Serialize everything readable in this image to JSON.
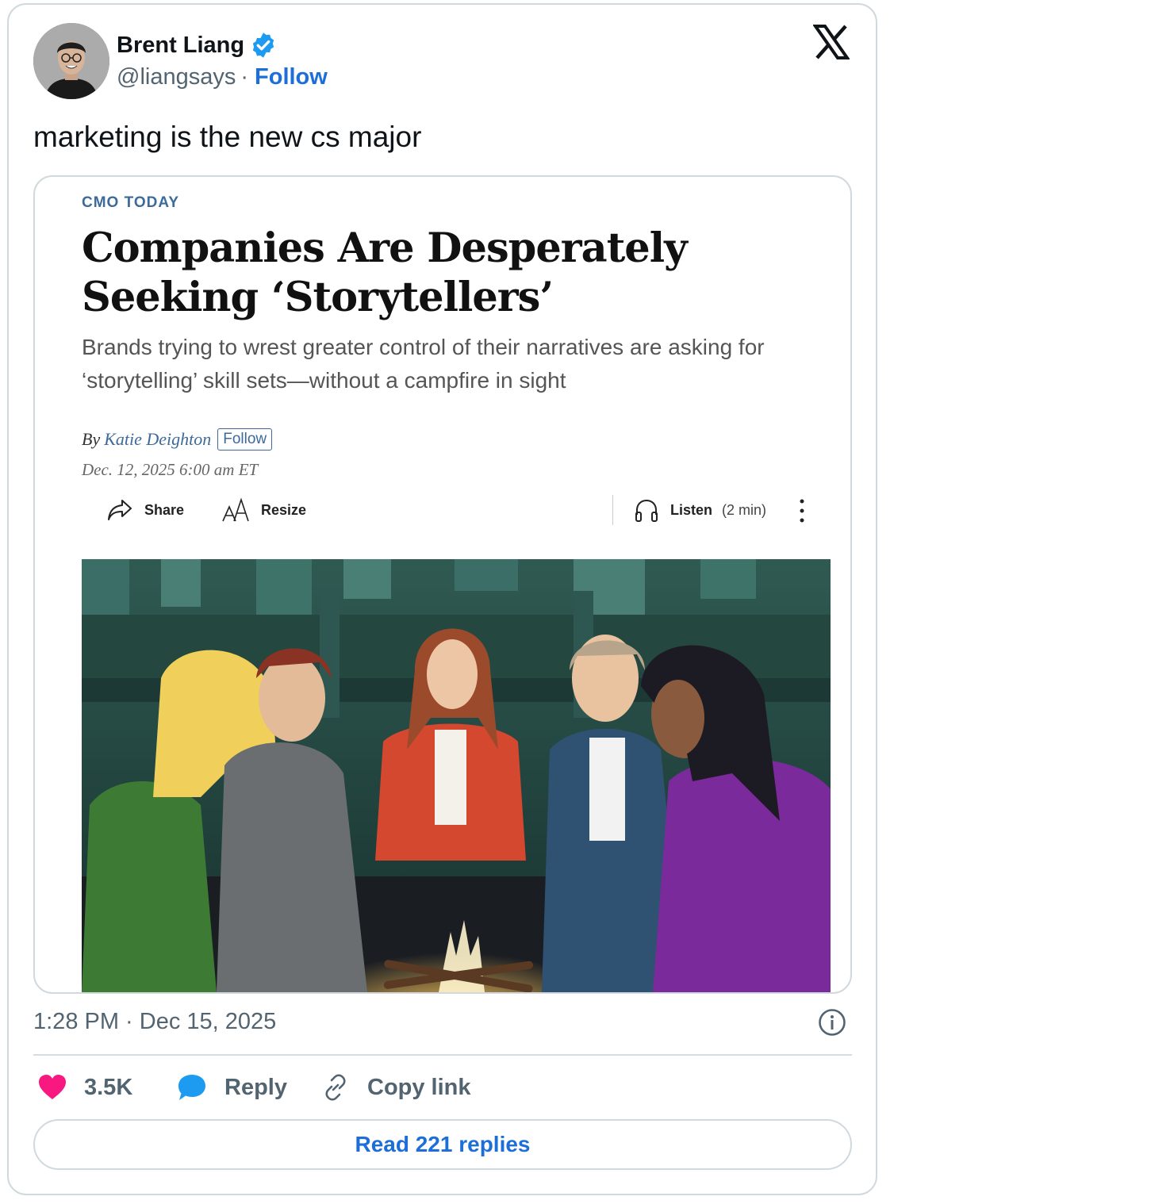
{
  "author": {
    "name": "Brent Liang",
    "handle": "@liangsays",
    "separator": "·",
    "follow_label": "Follow"
  },
  "tweet": {
    "text": "marketing is the new cs major",
    "timestamp": "1:28 PM · Dec 15, 2025"
  },
  "article": {
    "kicker": "CMO TODAY",
    "headline": "Companies Are Desperately Seeking ‘Storytellers’",
    "dek": "Brands trying to wrest greater control of their narratives are asking for ‘storytelling’ skill sets—without a campfire in sight",
    "byline_prefix": "By",
    "author": "Katie Deighton",
    "follow_label": "Follow",
    "date": "Dec. 12, 2025 6:00 am ET",
    "toolbar": {
      "share": "Share",
      "resize": "Resize",
      "listen": "Listen",
      "listen_duration": "(2 min)"
    }
  },
  "actions": {
    "likes": "3.5K",
    "reply": "Reply",
    "copy_link": "Copy link",
    "read_replies": "Read 221 replies"
  },
  "icons": [
    "verified-badge-icon",
    "x-logo-icon",
    "share-icon",
    "resize-icon",
    "headphones-icon",
    "kebab-icon",
    "info-icon",
    "heart-icon",
    "reply-bubble-icon",
    "link-icon"
  ],
  "colors": {
    "link_blue": "#1d6ed8",
    "verified_blue": "#1d9bf0",
    "heart_pink": "#f91880",
    "wsj_blue": "#3c6a9c",
    "muted_text": "#536471"
  }
}
